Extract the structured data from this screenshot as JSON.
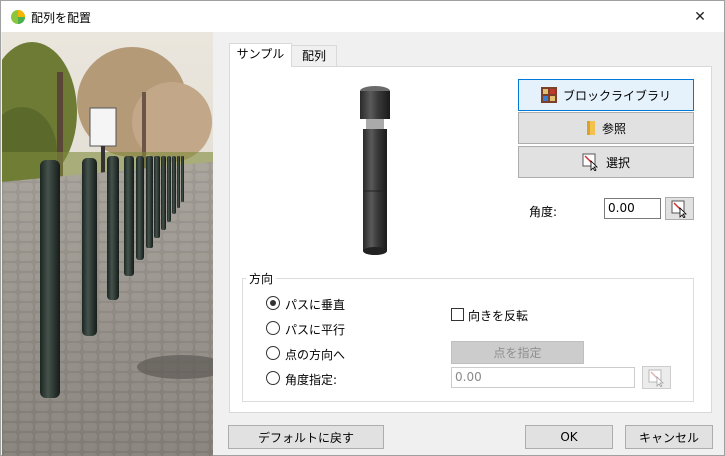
{
  "window": {
    "title": "配列を配置",
    "close_glyph": "✕"
  },
  "tabs": [
    {
      "label": "サンプル",
      "active": true
    },
    {
      "label": "配列",
      "active": false
    }
  ],
  "buttons": {
    "block_library": "ブロックライブラリ",
    "browse": "参照",
    "select": "選択",
    "specify_point": "点を指定",
    "default": "デフォルトに戻す",
    "ok": "OK",
    "cancel": "キャンセル"
  },
  "angle": {
    "label": "角度:",
    "value": "0.00"
  },
  "direction": {
    "title": "方向",
    "options": [
      {
        "label": "パスに垂直",
        "checked": true
      },
      {
        "label": "パスに平行",
        "checked": false
      },
      {
        "label": "点の方向へ",
        "checked": false
      },
      {
        "label": "角度指定:",
        "checked": false
      }
    ],
    "flip_label": "向きを反転",
    "flip_checked": false,
    "angle_value": "0.00"
  },
  "colors": {
    "focus_border": "#0078d7",
    "accent": "#e5f1fb"
  }
}
